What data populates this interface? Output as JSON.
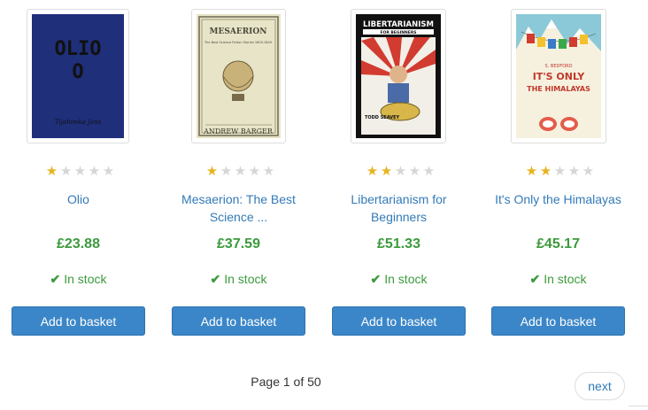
{
  "products": [
    {
      "title": "Olio",
      "title_line2": "",
      "rating": 1,
      "price": "£23.88",
      "stock": "In stock",
      "button": "Add to basket",
      "cover": {
        "bg": "#1f2f7a",
        "top": "OLIO",
        "bottom": "O",
        "author": "Tijahimka Jans"
      }
    },
    {
      "title": "Mesaerion: The Best",
      "title_line2": "Science ...",
      "rating": 1,
      "price": "£37.59",
      "stock": "In stock",
      "button": "Add to basket",
      "cover": {
        "bg": "#e8e4c8",
        "top": "MESAERION",
        "sub": "The Best Science Fiction Stories 1800-1849",
        "author": "ANDREW BARGER"
      }
    },
    {
      "title": "Libertarianism for",
      "title_line2": "Beginners",
      "rating": 2,
      "price": "£51.33",
      "stock": "In stock",
      "button": "Add to basket",
      "cover": {
        "bg": "#111111",
        "top": "LIBERTARIANISM",
        "sub": "FOR BEGINNERS",
        "author": "TODD SEAVEY"
      }
    },
    {
      "title": "It's Only the Himalayas",
      "title_line2": "",
      "rating": 2,
      "price": "£45.17",
      "stock": "In stock",
      "button": "Add to basket",
      "cover": {
        "bg": "#f6f1df",
        "top": "IT'S ONLY",
        "sub": "THE HIMALAYAS",
        "author": "S. BEDFORD"
      }
    }
  ],
  "pagination": {
    "text": "Page 1 of 50",
    "next": "next"
  },
  "colors": {
    "link": "#337ab7",
    "price": "#3c9a3c",
    "button": "#3b86c8",
    "star_on": "#e6b422",
    "star_off": "#d6d6d6"
  }
}
